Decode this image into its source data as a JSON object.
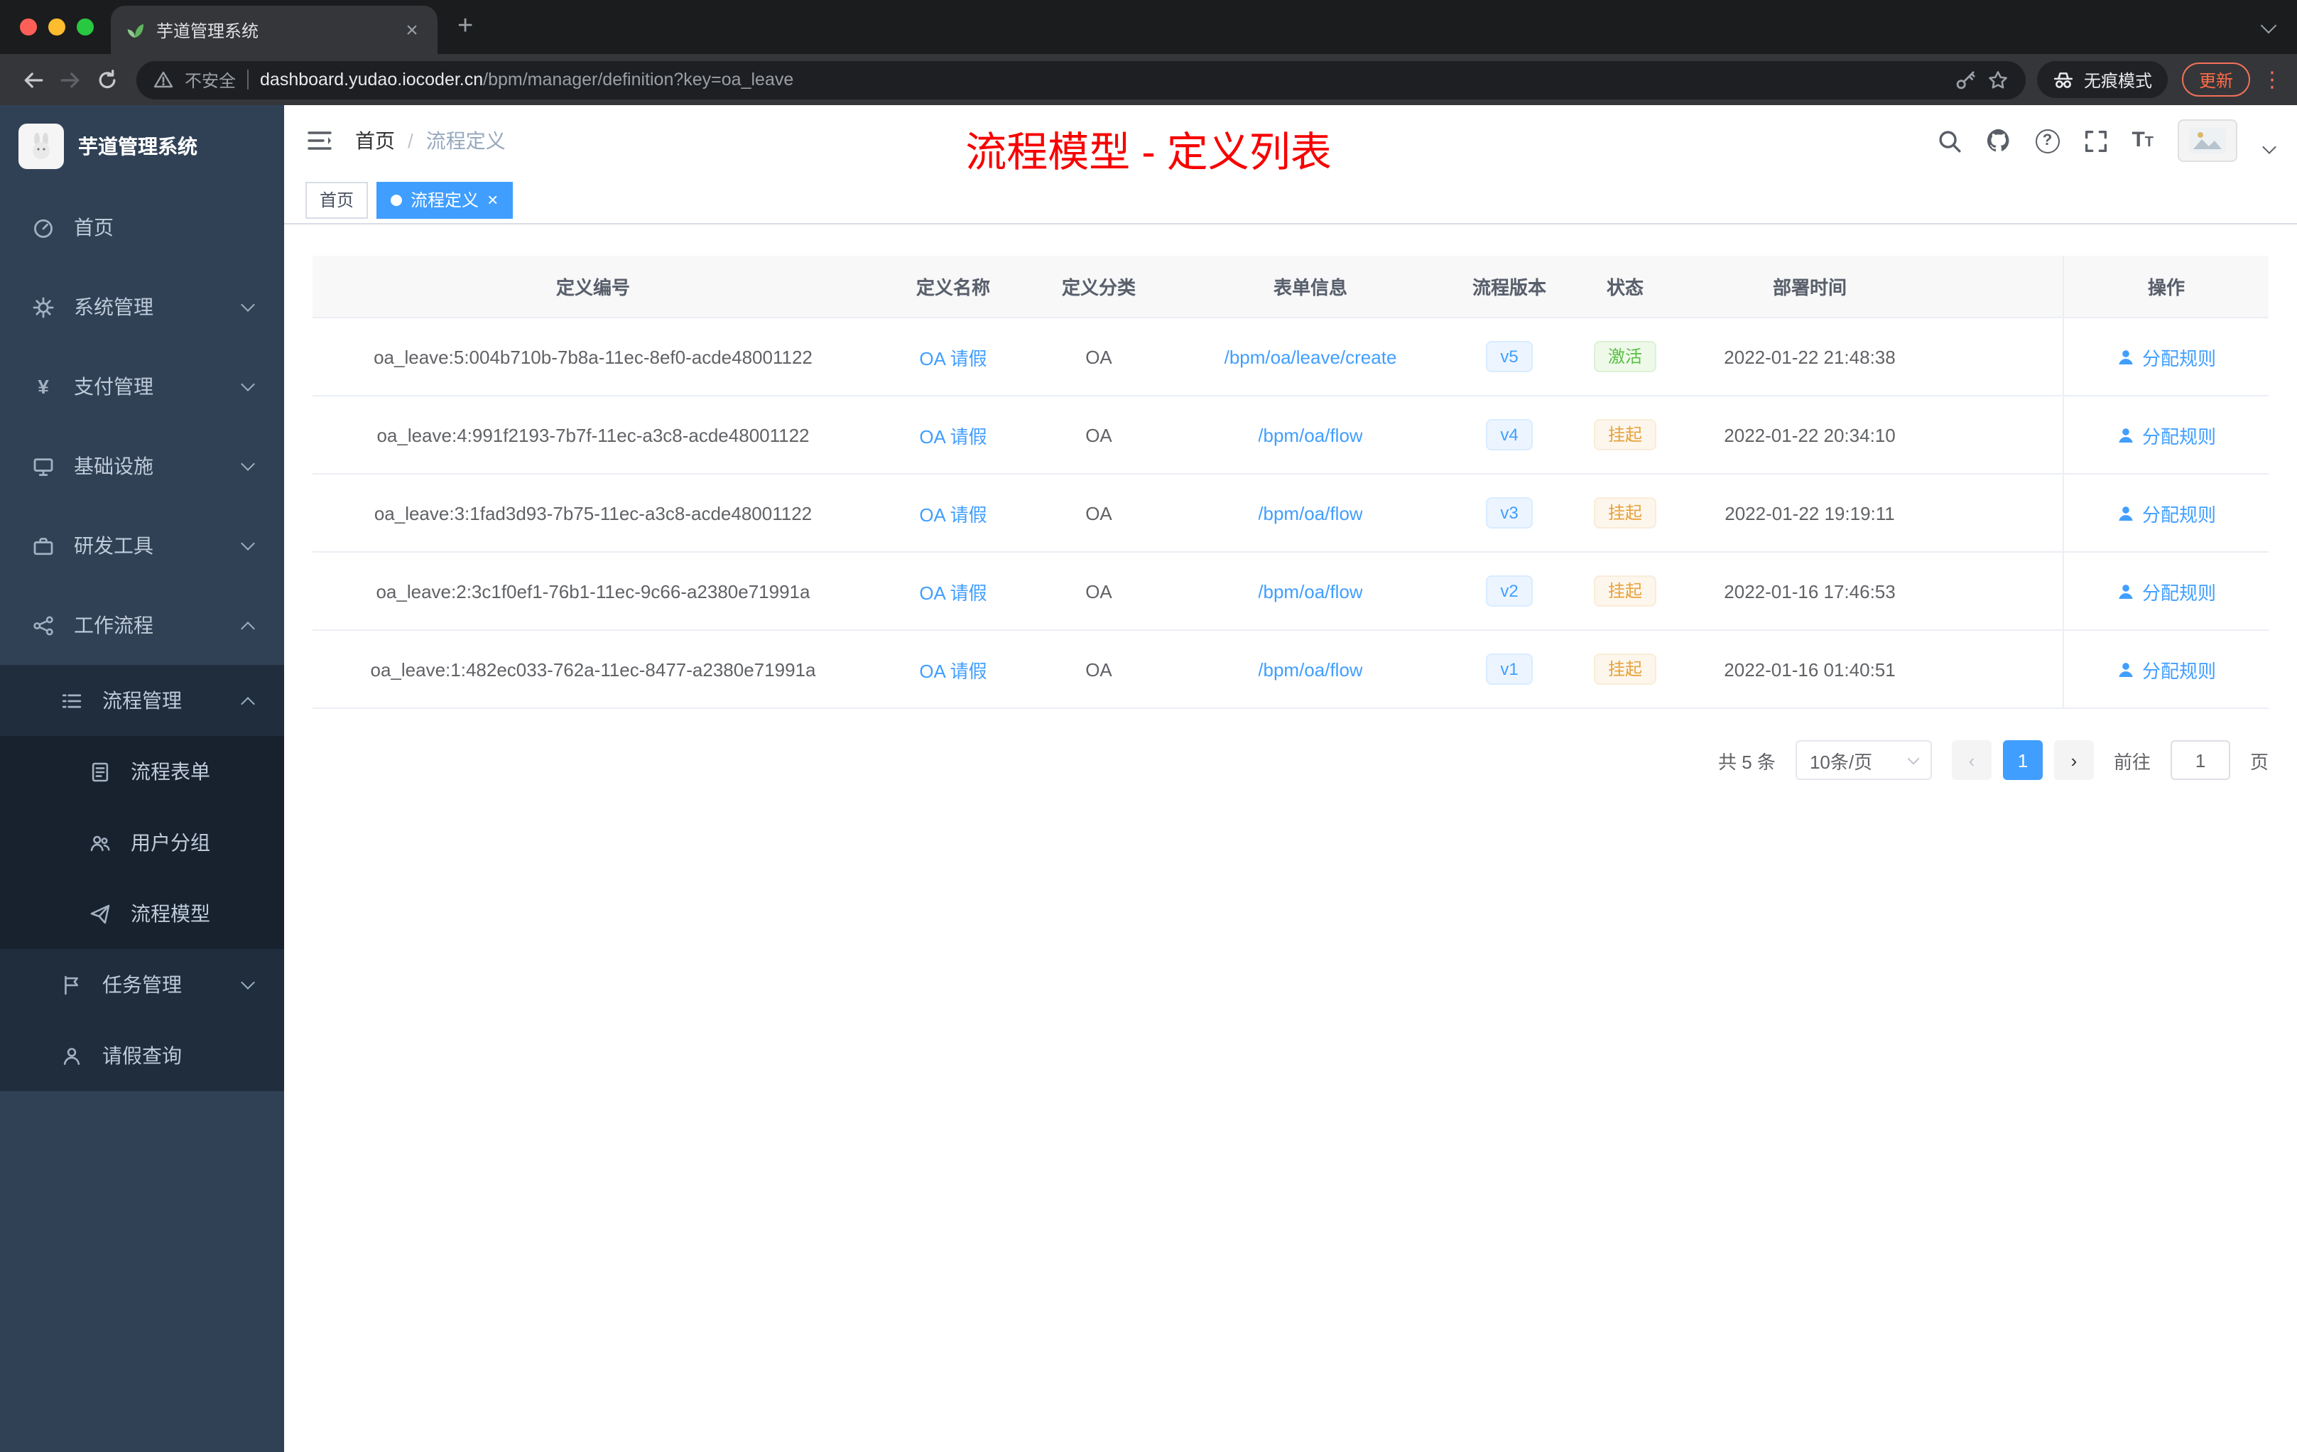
{
  "browser": {
    "tab_title": "芋道管理系统",
    "security_label": "不安全",
    "url_host": "dashboard.yudao.iocoder.cn",
    "url_path": "/bpm/manager/definition?key=oa_leave",
    "incognito_label": "无痕模式",
    "update_label": "更新"
  },
  "annotation": "流程模型 - 定义列表",
  "sidebar": {
    "title": "芋道管理系统",
    "items": [
      {
        "label": "首页",
        "icon": "home-icon"
      },
      {
        "label": "系统管理",
        "icon": "gear-icon"
      },
      {
        "label": "支付管理",
        "icon": "yen-icon"
      },
      {
        "label": "基础设施",
        "icon": "infrastructure-icon"
      },
      {
        "label": "研发工具",
        "icon": "devtools-icon"
      },
      {
        "label": "工作流程",
        "icon": "workflow-icon"
      },
      {
        "label": "流程管理",
        "icon": "process-list-icon"
      },
      {
        "label": "流程表单",
        "icon": "form-icon"
      },
      {
        "label": "用户分组",
        "icon": "user-group-icon"
      },
      {
        "label": "流程模型",
        "icon": "process-model-icon"
      },
      {
        "label": "任务管理",
        "icon": "task-icon"
      },
      {
        "label": "请假查询",
        "icon": "user-icon"
      }
    ]
  },
  "header": {
    "breadcrumb_home": "首页",
    "breadcrumb_separator": "/",
    "breadcrumb_current": "流程定义"
  },
  "tags": [
    {
      "label": "首页"
    },
    {
      "label": "流程定义"
    }
  ],
  "table": {
    "columns": [
      "定义编号",
      "定义名称",
      "定义分类",
      "表单信息",
      "流程版本",
      "状态",
      "部署时间",
      "操作"
    ],
    "rows": [
      {
        "id": "oa_leave:5:004b710b-7b8a-11ec-8ef0-acde48001122",
        "name": "OA 请假",
        "category": "OA",
        "form": "/bpm/oa/leave/create",
        "version": "v5",
        "status": "激活",
        "time": "2022-01-22 21:48:38",
        "action": "分配规则"
      },
      {
        "id": "oa_leave:4:991f2193-7b7f-11ec-a3c8-acde48001122",
        "name": "OA 请假",
        "category": "OA",
        "form": "/bpm/oa/flow",
        "version": "v4",
        "status": "挂起",
        "time": "2022-01-22 20:34:10",
        "action": "分配规则"
      },
      {
        "id": "oa_leave:3:1fad3d93-7b75-11ec-a3c8-acde48001122",
        "name": "OA 请假",
        "category": "OA",
        "form": "/bpm/oa/flow",
        "version": "v3",
        "status": "挂起",
        "time": "2022-01-22 19:19:11",
        "action": "分配规则"
      },
      {
        "id": "oa_leave:2:3c1f0ef1-76b1-11ec-9c66-a2380e71991a",
        "name": "OA 请假",
        "category": "OA",
        "form": "/bpm/oa/flow",
        "version": "v2",
        "status": "挂起",
        "time": "2022-01-16 17:46:53",
        "action": "分配规则"
      },
      {
        "id": "oa_leave:1:482ec033-762a-11ec-8477-a2380e71991a",
        "name": "OA 请假",
        "category": "OA",
        "form": "/bpm/oa/flow",
        "version": "v1",
        "status": "挂起",
        "time": "2022-01-16 01:40:51",
        "action": "分配规则"
      }
    ]
  },
  "pagination": {
    "total": "共 5 条",
    "page_size": "10条/页",
    "current_page": "1",
    "goto_label": "前往",
    "goto_value": "1",
    "goto_unit": "页"
  },
  "icons": {
    "close": "×",
    "plus": "+",
    "prev": "‹",
    "next": "›",
    "kebab": "⋮",
    "question": "?",
    "yen": "¥"
  },
  "colors": {
    "accent": "#409eff",
    "success": "#67c23a",
    "warning": "#e6a23c",
    "annotation_red": "#f80000",
    "sidebar_bg": "#304156",
    "submenu_bg": "#1f2d3d"
  }
}
